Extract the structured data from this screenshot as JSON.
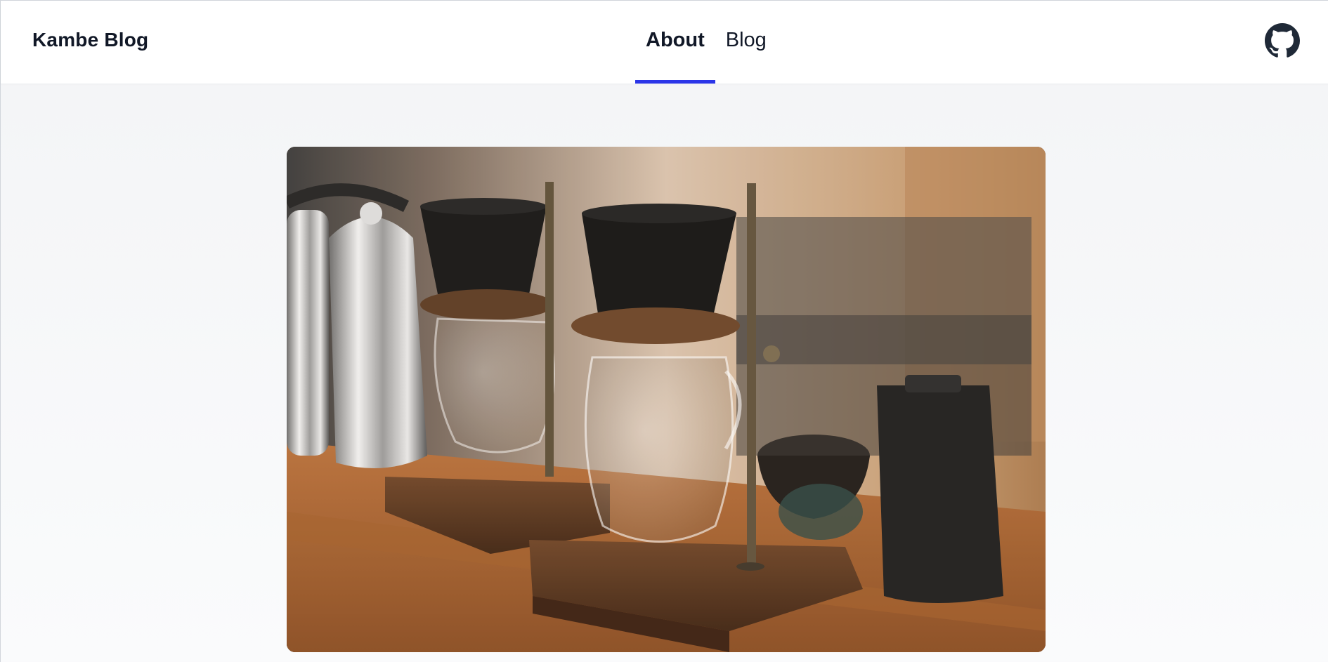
{
  "header": {
    "brand": "Kambe Blog",
    "nav": [
      {
        "label": "About",
        "active": true
      },
      {
        "label": "Blog",
        "active": false
      }
    ],
    "github_icon": "github-icon",
    "accent_color": "#2b35e8"
  },
  "hero": {
    "image": "coffee-drippers-photo"
  }
}
